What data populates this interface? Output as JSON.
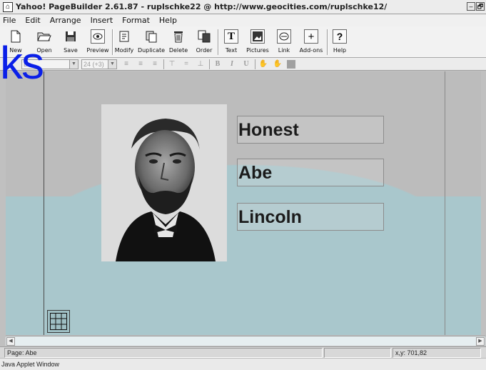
{
  "window": {
    "title": "Yahoo! PageBuilder 2.61.87 - ruplschke22 @ http://www.geocities.com/ruplschke12/",
    "minimize_glyph": "–",
    "maximize_glyph": "🗗"
  },
  "menu": [
    "File",
    "Edit",
    "Arrange",
    "Insert",
    "Format",
    "Help"
  ],
  "toolbar": {
    "new": "New",
    "open": "Open",
    "save": "Save",
    "preview": "Preview",
    "modify": "Modify",
    "duplicate": "Duplicate",
    "delete": "Delete",
    "order": "Order",
    "text": "Text",
    "pictures": "Pictures",
    "link": "Link",
    "addons": "Add-ons",
    "help": "Help"
  },
  "formatbar": {
    "font_value": "Bo",
    "size_value": "24 (+3)",
    "bold": "B",
    "italic": "I",
    "underline": "U"
  },
  "overlay_text": "ks",
  "canvas": {
    "textboxes": [
      "Honest",
      "Abe",
      "Lincoln"
    ],
    "grid_tool": "grid-icon"
  },
  "status": {
    "page": "Page: Abe",
    "coords": "x,y: 701,82",
    "applet": "Java Applet Window"
  },
  "colors": {
    "overlay_blue": "#0a1fe8",
    "teal_band": "#a9c7cc",
    "workspace_gray": "#bcbcbc"
  }
}
